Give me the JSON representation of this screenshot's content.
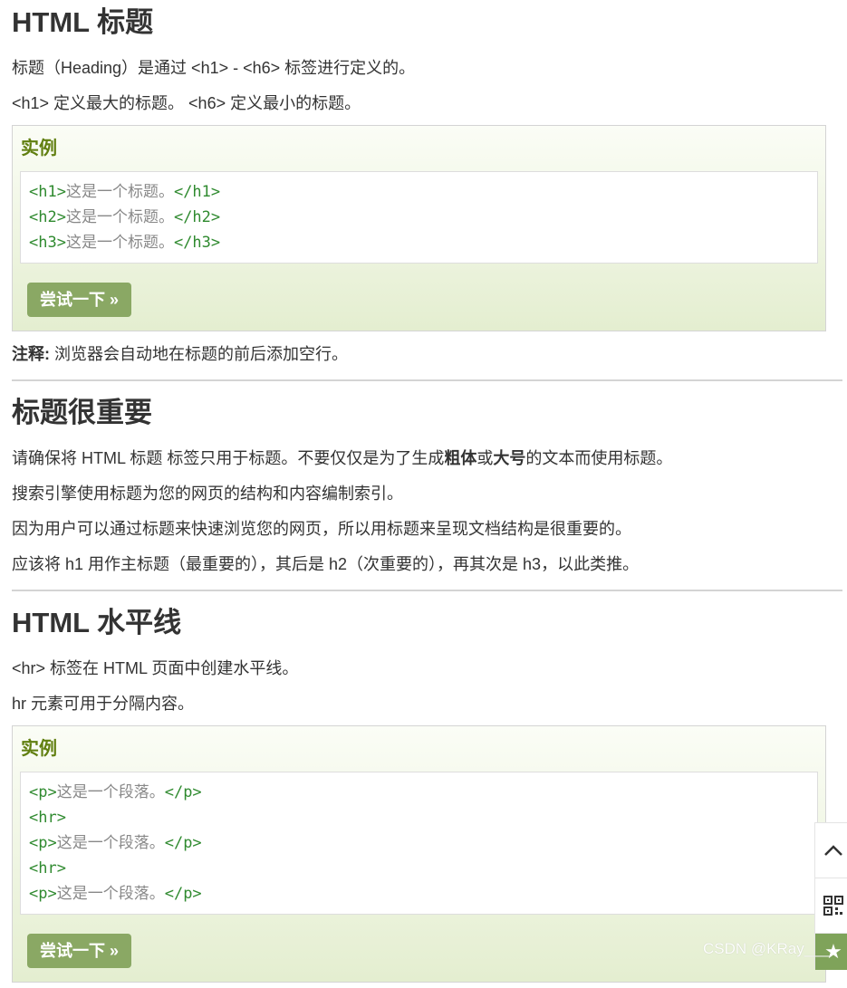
{
  "sections": {
    "headings": {
      "title": "HTML 标题",
      "p1": "标题（Heading）是通过 <h1> - <h6> 标签进行定义的。",
      "p2": "<h1> 定义最大的标题。 <h6> 定义最小的标题。",
      "example_label": "实例",
      "code": [
        {
          "open": "<h1>",
          "text": "这是一个标题。",
          "close": "</h1>"
        },
        {
          "open": "<h2>",
          "text": "这是一个标题。",
          "close": "</h2>"
        },
        {
          "open": "<h3>",
          "text": "这是一个标题。",
          "close": "</h3>"
        }
      ],
      "try_label": "尝试一下 »",
      "note_label": "注释:",
      "note_text": " 浏览器会自动地在标题的前后添加空行。"
    },
    "importance": {
      "title": "标题很重要",
      "p1_pre": "请确保将 HTML 标题 标签只用于标题。不要仅仅是为了生成",
      "p1_bold1": "粗体",
      "p1_mid": "或",
      "p1_bold2": "大号",
      "p1_post": "的文本而使用标题。",
      "p2": "搜索引擎使用标题为您的网页的结构和内容编制索引。",
      "p3": "因为用户可以通过标题来快速浏览您的网页，所以用标题来呈现文档结构是很重要的。",
      "p4": "应该将 h1 用作主标题（最重要的），其后是 h2（次重要的），再其次是 h3，以此类推。"
    },
    "hr": {
      "title": "HTML 水平线",
      "p1": "<hr> 标签在 HTML 页面中创建水平线。",
      "p2": "hr 元素可用于分隔内容。",
      "example_label": "实例",
      "code": [
        {
          "open": "<p>",
          "text": "这是一个段落。",
          "close": "</p>"
        },
        {
          "open": "<hr>",
          "text": "",
          "close": ""
        },
        {
          "open": "<p>",
          "text": "这是一个段落。",
          "close": "</p>"
        },
        {
          "open": "<hr>",
          "text": "",
          "close": ""
        },
        {
          "open": "<p>",
          "text": "这是一个段落。",
          "close": "</p>"
        }
      ],
      "try_label": "尝试一下 »"
    }
  },
  "toolbar": {
    "icons": [
      "chevron-up-icon",
      "qr-code-icon",
      "star-icon"
    ]
  },
  "watermark": "CSDN @KRay___",
  "colors": {
    "example_heading": "#617f10",
    "try_button": "#8aa864",
    "tag": "#2f8a2f",
    "code_text": "#888888"
  }
}
